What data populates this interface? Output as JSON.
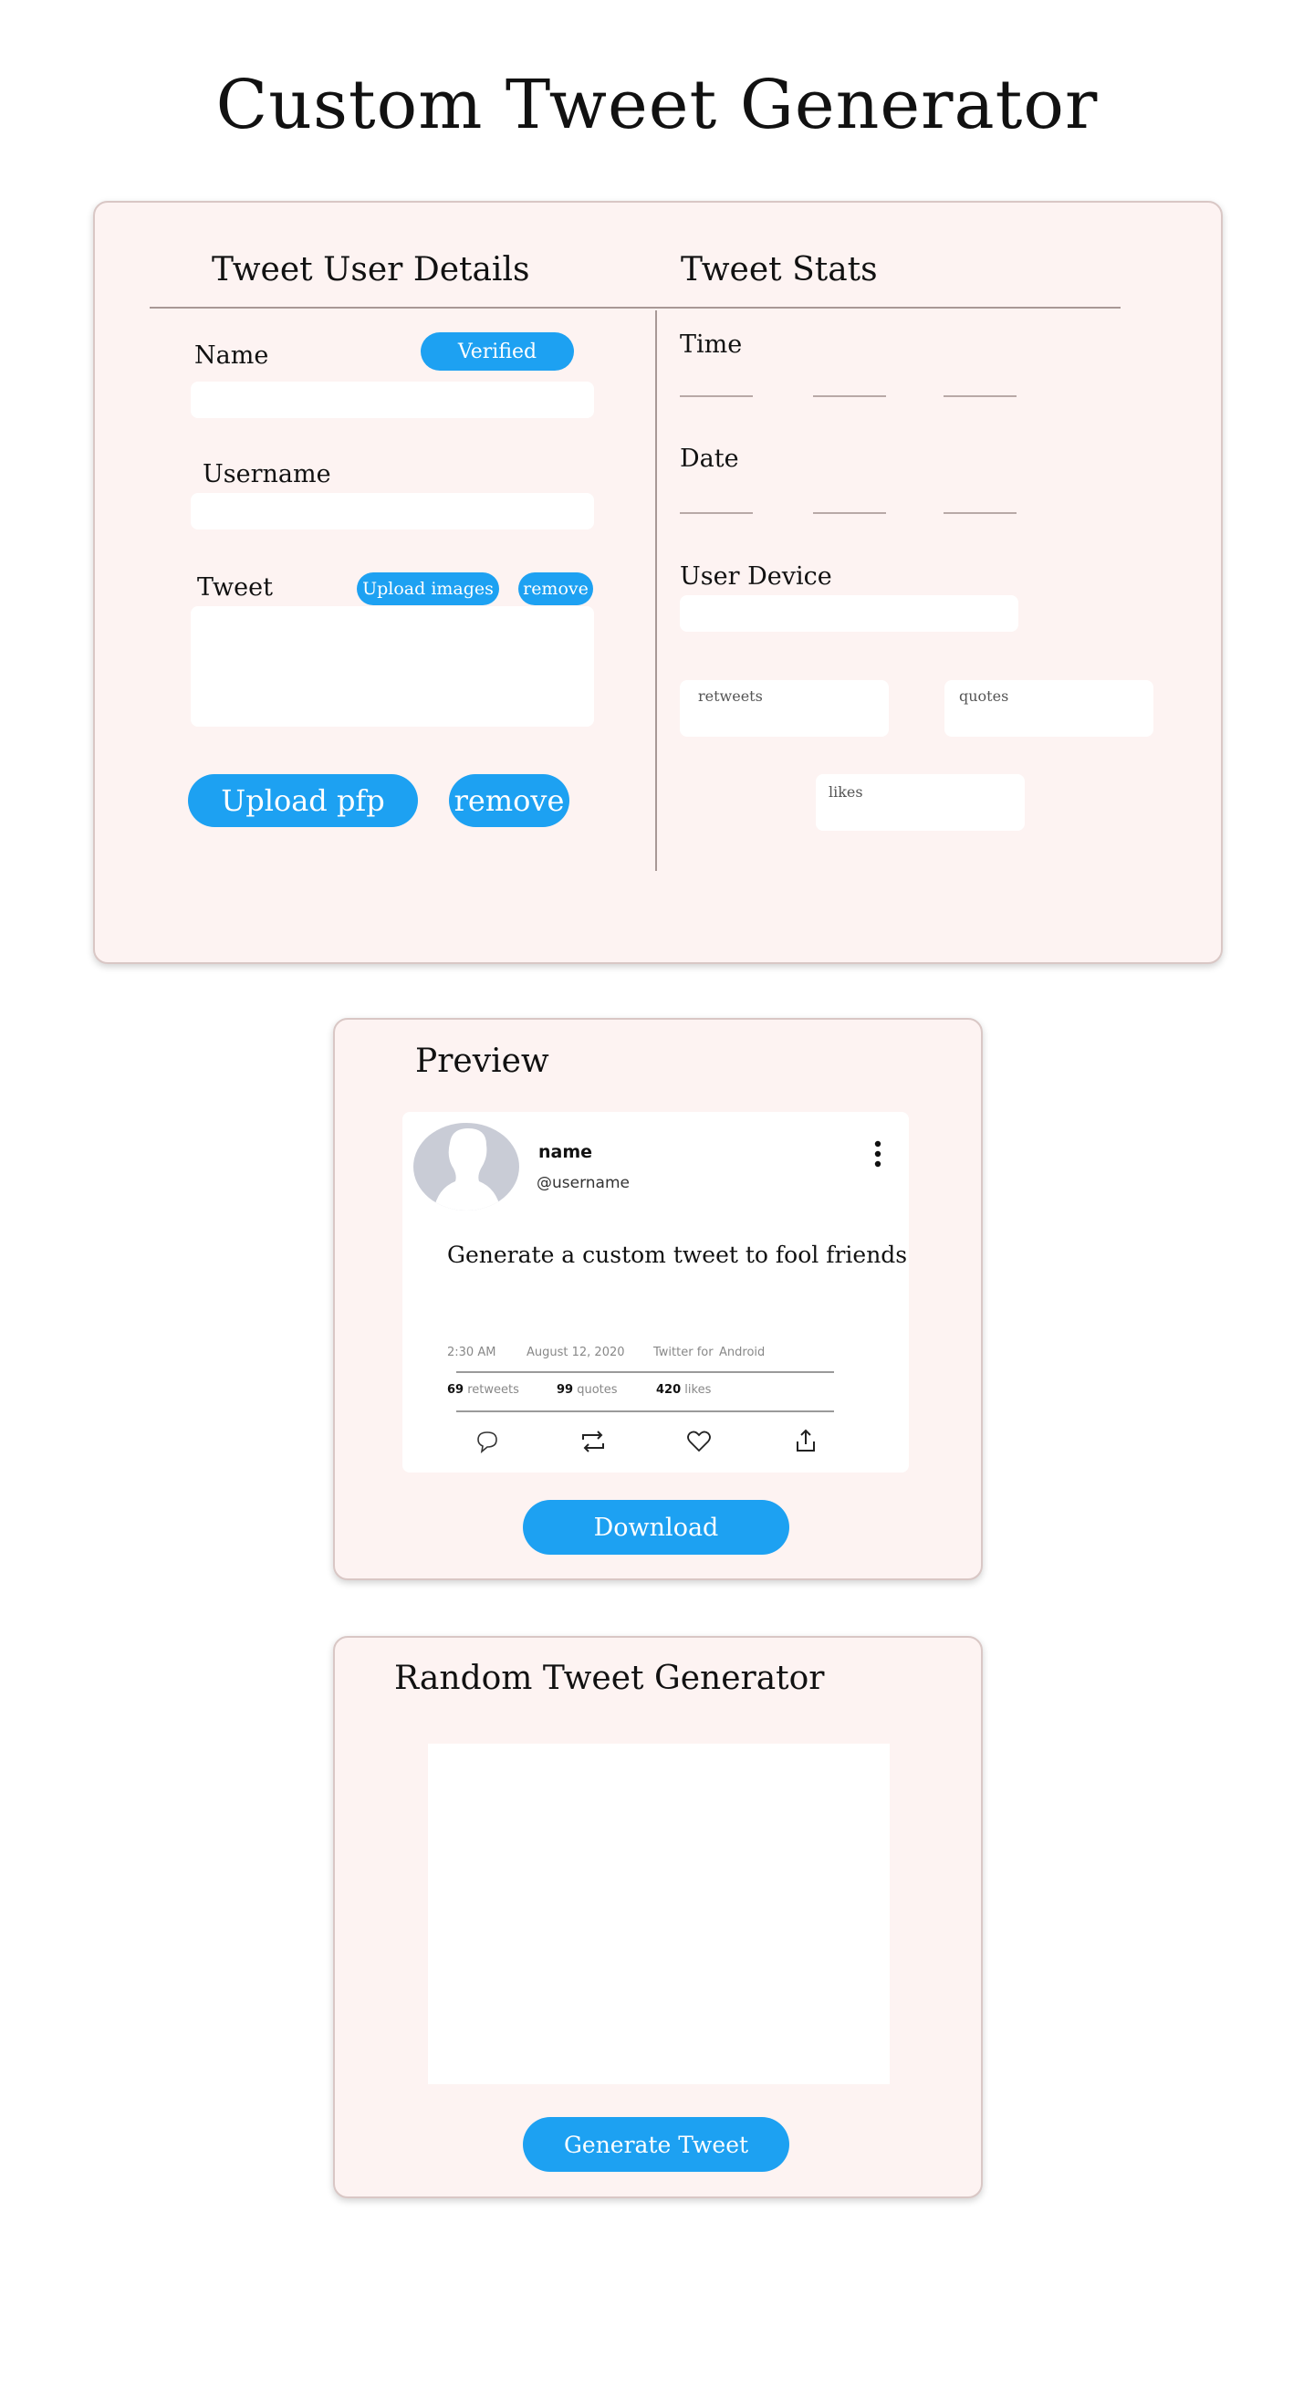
{
  "page": {
    "title": "Custom Tweet Generator"
  },
  "details": {
    "heading": "Tweet User Details",
    "name_label": "Name",
    "verified_label": "Verified",
    "username_label": "Username",
    "tweet_label": "Tweet",
    "upload_images_label": "Upload images",
    "remove_images_label": "remove",
    "upload_pfp_label": "Upload pfp",
    "remove_pfp_label": "remove"
  },
  "stats": {
    "heading": "Tweet Stats",
    "time_label": "Time",
    "date_label": "Date",
    "device_label": "User Device",
    "retweets_placeholder": "retweets",
    "quotes_placeholder": "quotes",
    "likes_placeholder": "likes"
  },
  "preview": {
    "heading": "Preview",
    "name": "name",
    "username": "@username",
    "text": "Generate a custom tweet to fool friends",
    "time": "2:30 AM",
    "date": "August 12, 2020",
    "via": "Twitter for",
    "device": "Android",
    "retweets_count": "69",
    "retweets_word": "retweets",
    "quotes_count": "99",
    "quotes_word": "quotes",
    "likes_count": "420",
    "likes_word": "likes",
    "download_label": "Download"
  },
  "random": {
    "heading": "Random Tweet Generator",
    "generate_label": "Generate Tweet"
  },
  "colors": {
    "accent": "#1da1f2",
    "panel_bg": "#fdf3f2",
    "avatar": "#c9ccd6"
  },
  "icons": [
    "reply-icon",
    "retweet-icon",
    "like-icon",
    "share-icon",
    "more-icon"
  ]
}
